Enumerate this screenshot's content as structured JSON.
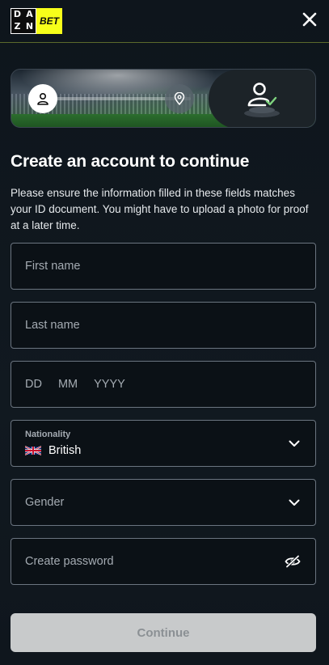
{
  "header": {
    "logo": {
      "dazn_letters": [
        "D",
        "A",
        "Z",
        "N"
      ],
      "bet_label": "BET",
      "bet_color": "#f7ff1a"
    },
    "close_icon": "close-icon"
  },
  "progress": {
    "steps": [
      {
        "icon": "user-icon",
        "state": "active"
      },
      {
        "icon": "location-pin-icon",
        "state": "pending"
      },
      {
        "icon": "user-check-icon",
        "state": "pending"
      }
    ]
  },
  "form": {
    "title": "Create an account to continue",
    "subtitle": "Please ensure the information filled in these fields matches your ID document. You might have to upload a photo for proof at a later time.",
    "first_name_placeholder": "First name",
    "last_name_placeholder": "Last name",
    "dob": {
      "day_placeholder": "DD",
      "month_placeholder": "MM",
      "year_placeholder": "YYYY"
    },
    "nationality": {
      "label": "Nationality",
      "value": "British",
      "flag_icon": "uk-flag-icon"
    },
    "gender_placeholder": "Gender",
    "password_placeholder": "Create password",
    "continue_label": "Continue"
  }
}
